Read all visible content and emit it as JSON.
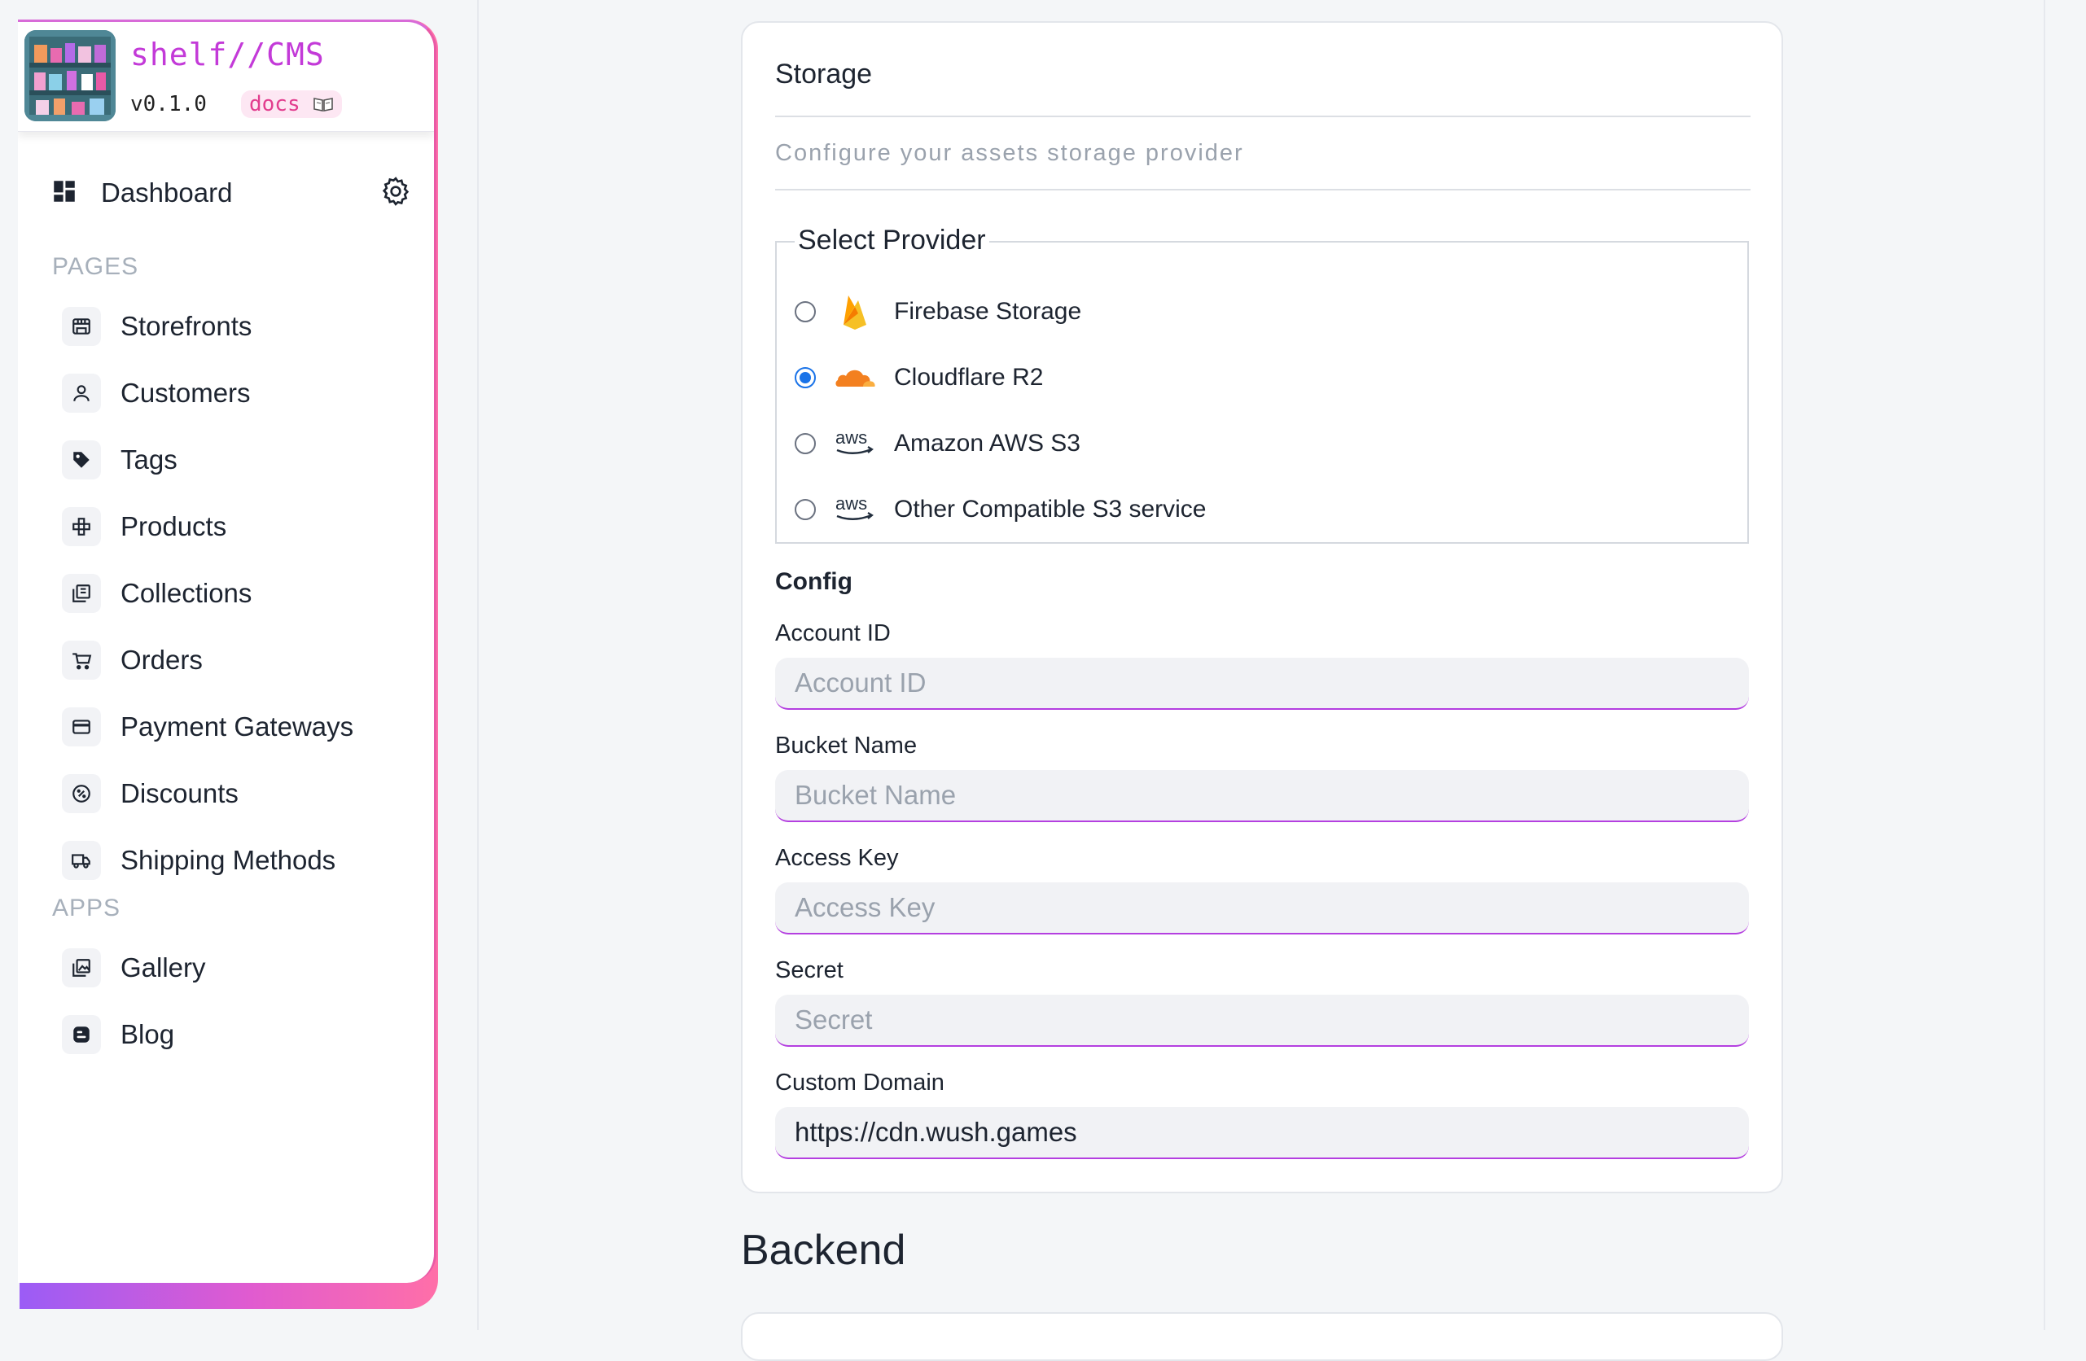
{
  "brand": {
    "name": "shelf//CMS",
    "version": "v0.1.0",
    "docs_label": "docs"
  },
  "sidebar": {
    "dashboard_label": "Dashboard",
    "pages_title": "PAGES",
    "pages": [
      {
        "label": "Storefronts",
        "icon": "storefront-icon"
      },
      {
        "label": "Customers",
        "icon": "person-icon"
      },
      {
        "label": "Tags",
        "icon": "tag-icon"
      },
      {
        "label": "Products",
        "icon": "products-icon"
      },
      {
        "label": "Collections",
        "icon": "collections-icon"
      },
      {
        "label": "Orders",
        "icon": "cart-icon"
      },
      {
        "label": "Payment Gateways",
        "icon": "credit-card-icon"
      },
      {
        "label": "Discounts",
        "icon": "discount-icon"
      },
      {
        "label": "Shipping Methods",
        "icon": "truck-icon"
      }
    ],
    "apps_title": "APPS",
    "apps": [
      {
        "label": "Gallery",
        "icon": "gallery-icon"
      },
      {
        "label": "Blog",
        "icon": "blog-icon"
      }
    ]
  },
  "storage": {
    "title": "Storage",
    "subtitle": "Configure your assets storage provider",
    "select_provider_legend": "Select Provider",
    "providers": [
      {
        "label": "Firebase Storage",
        "icon": "firebase-icon",
        "selected": false
      },
      {
        "label": "Cloudflare R2",
        "icon": "cloudflare-icon",
        "selected": true
      },
      {
        "label": "Amazon AWS S3",
        "icon": "aws-icon",
        "selected": false
      },
      {
        "label": "Other Compatible S3 service",
        "icon": "aws-icon",
        "selected": false
      }
    ],
    "aws_logo_text": "aws",
    "config_title": "Config",
    "fields": [
      {
        "label": "Account ID",
        "placeholder": "Account ID",
        "value": ""
      },
      {
        "label": "Bucket Name",
        "placeholder": "Bucket Name",
        "value": ""
      },
      {
        "label": "Access Key",
        "placeholder": "Access Key",
        "value": ""
      },
      {
        "label": "Secret",
        "placeholder": "Secret",
        "value": ""
      },
      {
        "label": "Custom Domain",
        "placeholder": "",
        "value": "https://cdn.wush.games"
      }
    ]
  },
  "backend": {
    "title": "Backend"
  },
  "colors": {
    "accent": "#c33ad8",
    "radio_selected": "#1a73e8",
    "input_underline": "#b43fe0"
  }
}
